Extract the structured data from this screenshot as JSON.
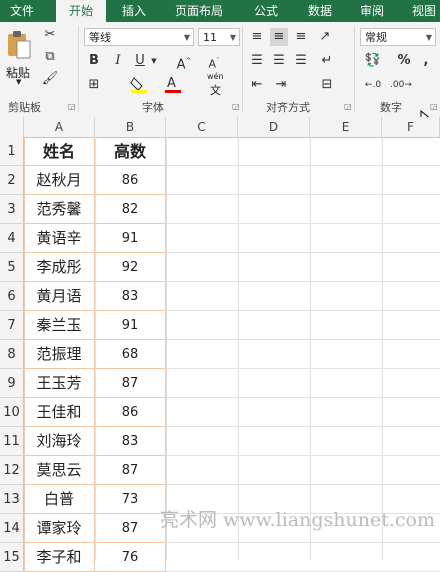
{
  "tabs": [
    "文件",
    "开始",
    "插入",
    "页面布局",
    "公式",
    "数据",
    "审阅",
    "视图"
  ],
  "active_tab": "开始",
  "ribbon": {
    "clipboard": {
      "paste_label": "粘贴",
      "group_label": "剪贴板"
    },
    "font": {
      "font_name": "等线",
      "font_size": "11",
      "group_label": "字体",
      "bold": "B",
      "italic": "I",
      "underline": "U",
      "wen": "wén",
      "wen_char": "文"
    },
    "alignment": {
      "group_label": "对齐方式"
    },
    "number": {
      "format": "常规",
      "group_label": "数字",
      "percent": "%",
      "comma": ","
    }
  },
  "columns": [
    "A",
    "B",
    "C",
    "D",
    "E",
    "F"
  ],
  "rows": [
    "1",
    "2",
    "3",
    "4",
    "5",
    "6",
    "7",
    "8",
    "9",
    "10",
    "11",
    "12",
    "13",
    "14",
    "15"
  ],
  "table": {
    "headers": [
      "姓名",
      "高数"
    ],
    "data": [
      [
        "赵秋月",
        "86"
      ],
      [
        "范秀馨",
        "82"
      ],
      [
        "黄语辛",
        "91"
      ],
      [
        "李成彤",
        "92"
      ],
      [
        "黄月语",
        "83"
      ],
      [
        "秦兰玉",
        "91"
      ],
      [
        "范振理",
        "68"
      ],
      [
        "王玉芳",
        "87"
      ],
      [
        "王佳和",
        "86"
      ],
      [
        "刘海玲",
        "83"
      ],
      [
        "莫思云",
        "87"
      ],
      [
        "白普",
        "73"
      ],
      [
        "谭家玲",
        "87"
      ],
      [
        "李子和",
        "76"
      ]
    ]
  },
  "watermark": "亮术网 www.liangshunet.com"
}
